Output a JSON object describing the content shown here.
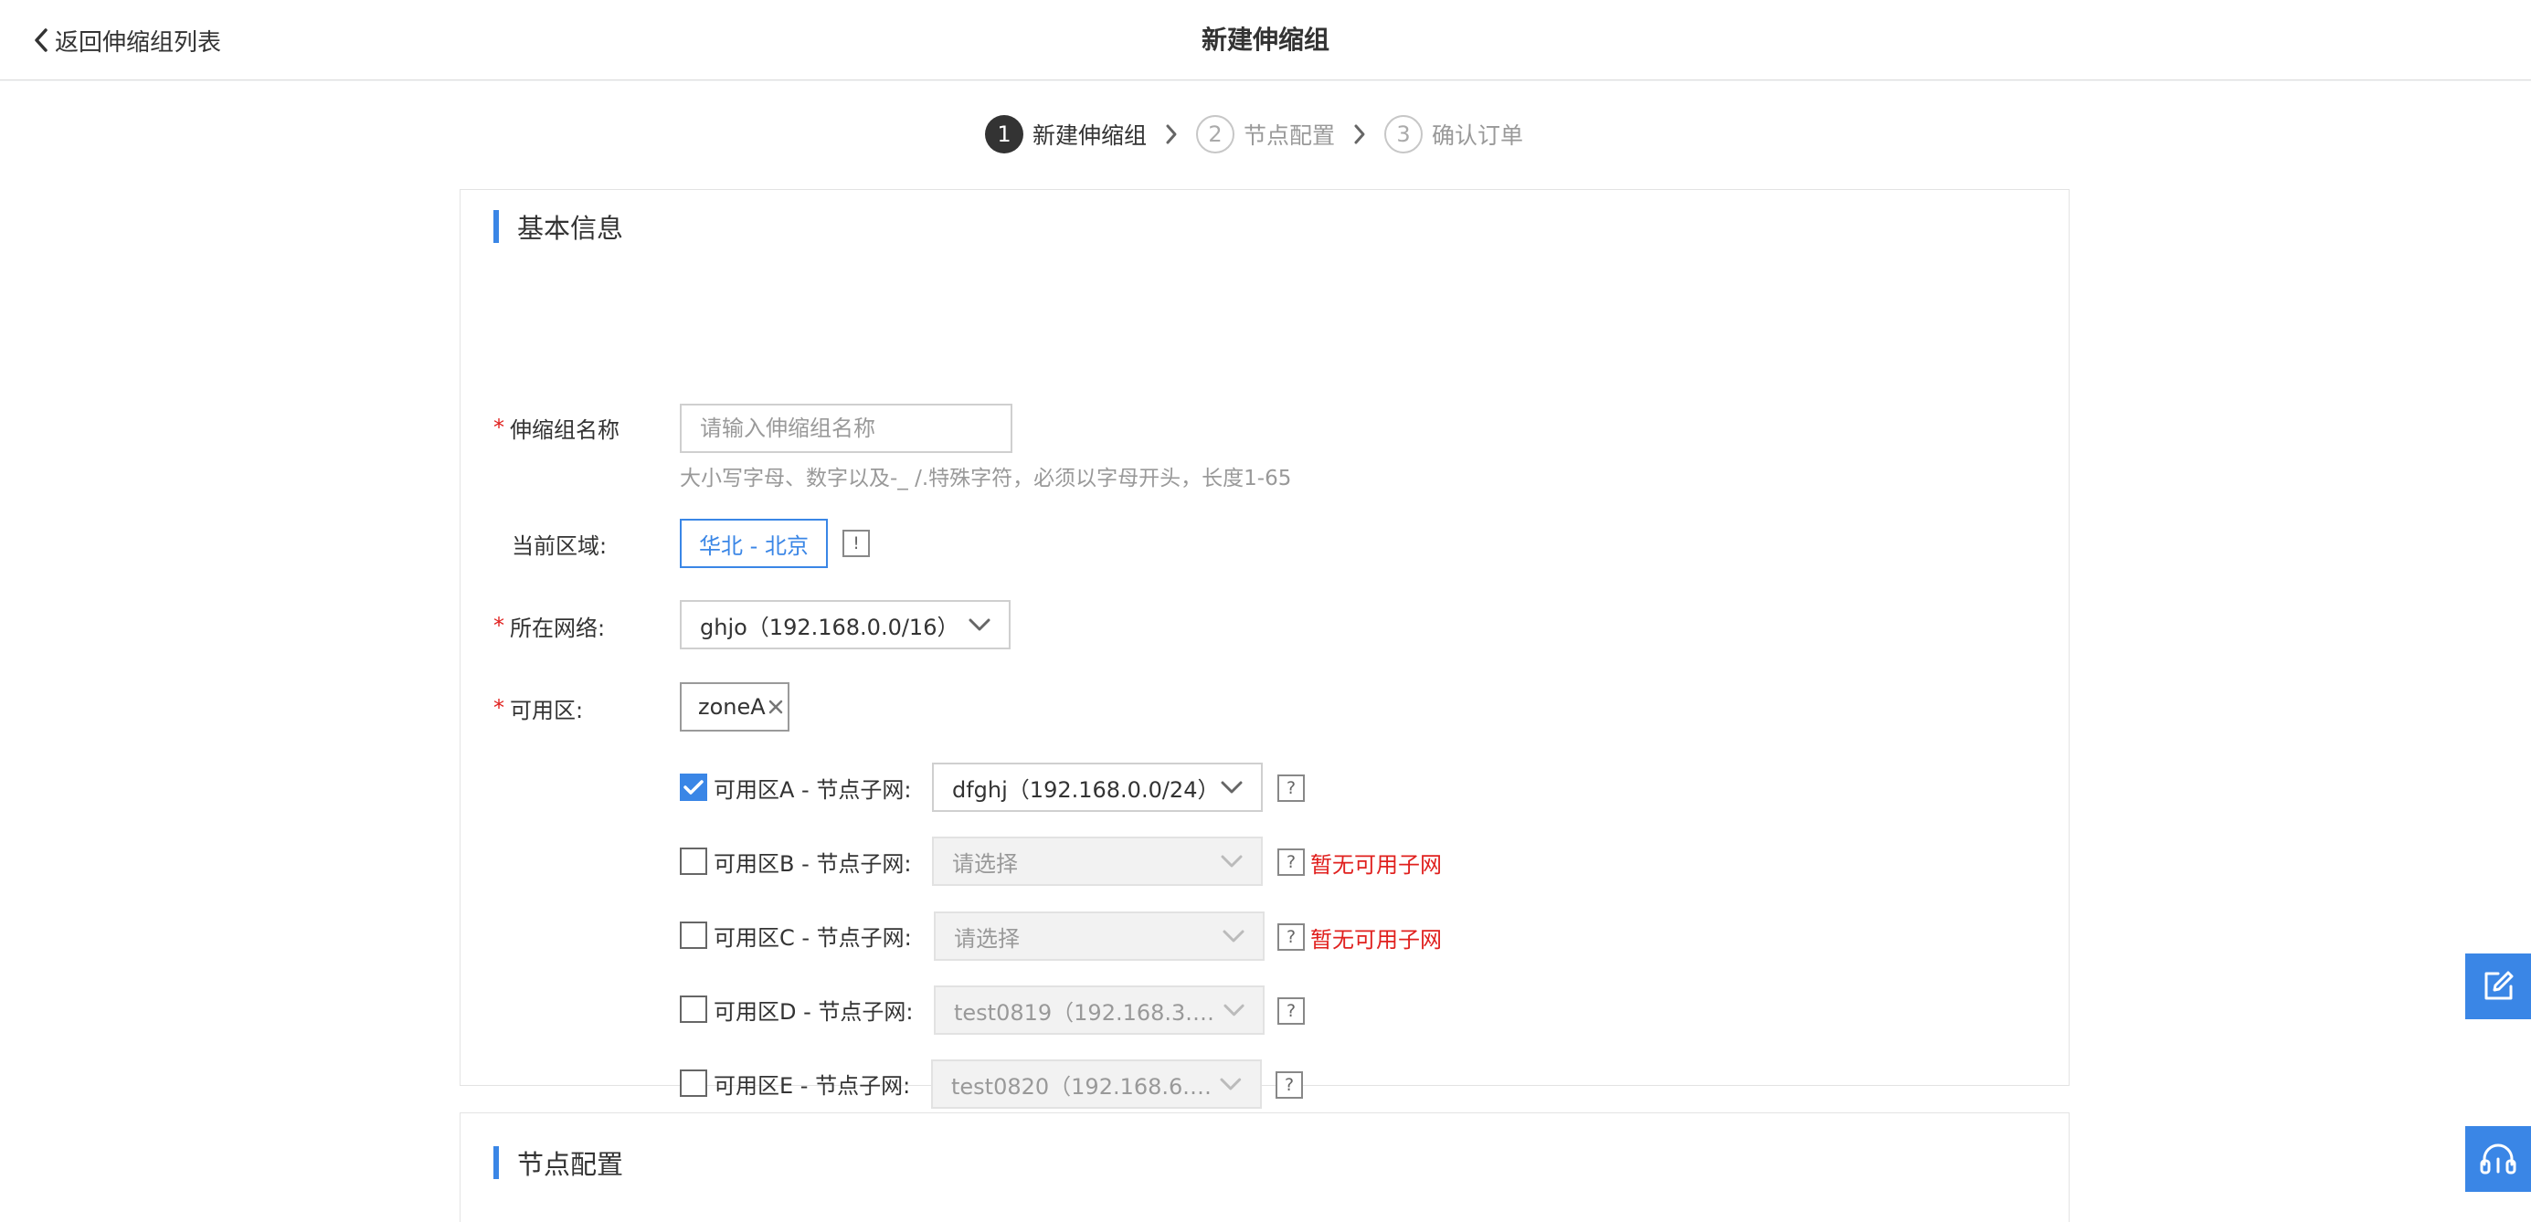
{
  "header": {
    "back_label": "返回伸缩组列表",
    "title": "新建伸缩组"
  },
  "steps": [
    {
      "num": "1",
      "label": "新建伸缩组",
      "state": "active"
    },
    {
      "num": "2",
      "label": "节点配置",
      "state": "inactive"
    },
    {
      "num": "3",
      "label": "确认订单",
      "state": "inactive"
    }
  ],
  "basic": {
    "section_title": "基本信息",
    "name_label": "伸缩组名称",
    "name_value": "",
    "name_placeholder": "请输入伸缩组名称",
    "name_hint": "大小写字母、数字以及-_ /.特殊字符，必须以字母开头，长度1-65",
    "region_label": "当前区域:",
    "region_value": "华北 - 北京",
    "region_info": "!",
    "network_label": "所在网络:",
    "network_value": "ghjo（192.168.0.0/16）",
    "zone_label": "可用区:",
    "zone_tag": "zoneA",
    "zones": [
      {
        "label": "可用区A - 节点子网:",
        "checked": true,
        "subnet": "dfghj（192.168.0.0/24）",
        "disabled": false,
        "help": "?",
        "warning": ""
      },
      {
        "label": "可用区B - 节点子网:",
        "checked": false,
        "subnet": "请选择",
        "disabled": true,
        "help": "?",
        "warning": "暂无可用子网"
      },
      {
        "label": "可用区C - 节点子网:",
        "checked": false,
        "subnet": "请选择",
        "disabled": true,
        "help": "?",
        "warning": "暂无可用子网"
      },
      {
        "label": "可用区D - 节点子网:",
        "checked": false,
        "subnet": "test0819（192.168.3.0/...",
        "disabled": true,
        "help": "?",
        "warning": ""
      },
      {
        "label": "可用区E - 节点子网:",
        "checked": false,
        "subnet": "test0820（192.168.6.0...",
        "disabled": true,
        "help": "?",
        "warning": ""
      }
    ]
  },
  "node": {
    "section_title": "节点配置"
  },
  "colors": {
    "accent": "#3a86e6",
    "required": "#e0201e",
    "warning": "#e0201e"
  },
  "float_buttons": [
    {
      "icon": "edit-icon"
    },
    {
      "icon": "headset-icon"
    }
  ]
}
